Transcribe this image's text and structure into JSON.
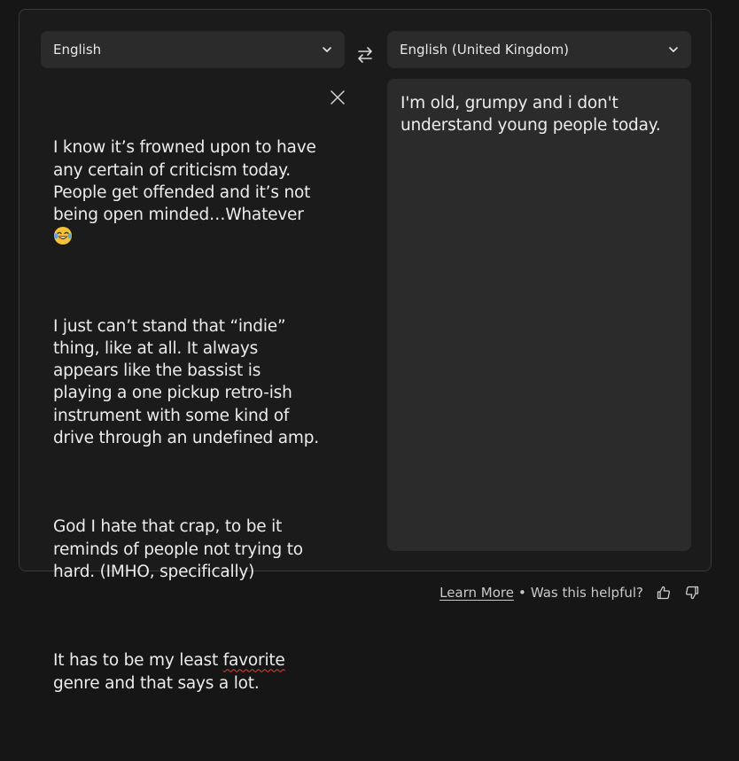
{
  "source_language": {
    "label": "English"
  },
  "target_language": {
    "label": "English (United Kingdom)"
  },
  "source_text": {
    "p1": "I know it’s frowned upon to have any certain of criticism today. People get offended and it’s not being open minded…Whatever",
    "p1_emoji": "laughing-tears-emoji",
    "p2": "I just can’t stand that “indie” thing, like at all. It always appears like the bassist is playing a one pickup retro-ish instrument with some kind of drive through an undefined amp.",
    "p3": "God I hate that crap, to be it reminds of people not trying to hard. (IMHO, specifically)",
    "p4_before": "It has to be my least ",
    "p4_misspelled": "favorite",
    "p4_after": " genre and that says a lot."
  },
  "translation": {
    "text": "I'm old, grumpy and i don't understand young people today."
  },
  "footer": {
    "learn_more": "Learn More",
    "separator": "•",
    "helpful": "Was this helpful?"
  },
  "icons": {
    "chevron": "chevron-down-icon",
    "swap": "swap-icon",
    "clear": "close-icon",
    "thumbs_up": "thumbs-up-icon",
    "thumbs_down": "thumbs-down-icon"
  },
  "colors": {
    "background": "#161616",
    "panel": "#1b1b1b",
    "input": "#2b2b2b",
    "text": "#ececec",
    "spellcheck": "#e0413a"
  }
}
